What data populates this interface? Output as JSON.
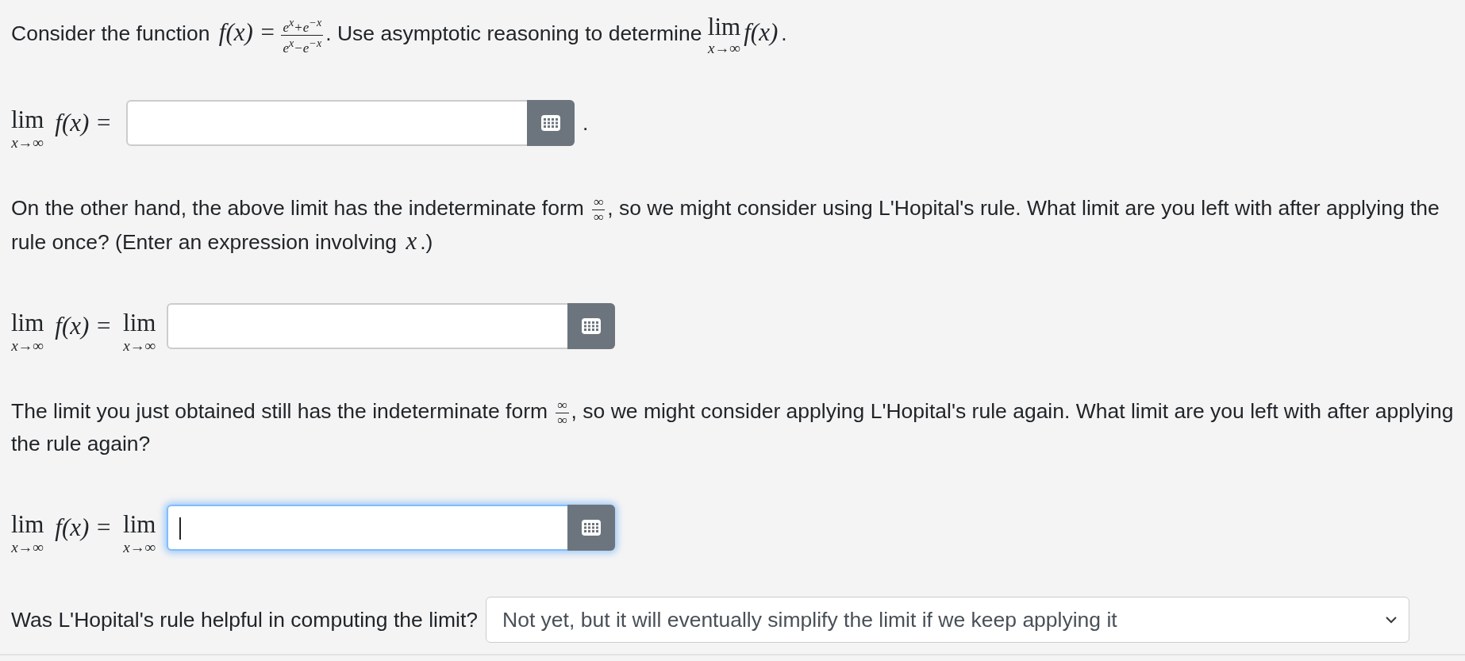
{
  "blocks": [
    {
      "kind": "p",
      "parts": [
        {
          "kind": "text",
          "text": "Consider the function "
        },
        {
          "kind": "math",
          "text": "f(x) ="
        },
        {
          "kind": "frac",
          "num": "e$^{x}$+e$^{−x}$",
          "den": "e$^{x}$−e$^{−x}$"
        },
        {
          "kind": "text",
          "text": ". Use asymptotic reasoning to determine "
        },
        {
          "kind": "lim",
          "text": "lim",
          "sub": "x→∞"
        },
        {
          "kind": "math",
          "text": "f(x)"
        },
        {
          "kind": "text",
          "text": "."
        }
      ]
    },
    {
      "kind": "answer",
      "focused": false,
      "parts": [
        {
          "kind": "lim",
          "text": "lim",
          "sub": "x→∞"
        },
        {
          "kind": "math",
          "text": "f(x) ="
        }
      ],
      "after": "."
    },
    {
      "kind": "p",
      "parts": [
        {
          "kind": "text",
          "text": "On the other hand, the above limit has the indeterminate form "
        },
        {
          "kind": "frac",
          "num": "∞",
          "den": "∞"
        },
        {
          "kind": "text",
          "text": ", so we might consider using L'Hopital's rule. What limit are you left with after applying the rule once? (Enter an expression involving "
        },
        {
          "kind": "math",
          "text": "x"
        },
        {
          "kind": "text",
          "text": ".)"
        }
      ]
    },
    {
      "kind": "answer",
      "focused": false,
      "parts": [
        {
          "kind": "lim",
          "text": "lim",
          "sub": "x→∞"
        },
        {
          "kind": "math",
          "text": "f(x) ="
        },
        {
          "kind": "lim",
          "text": "lim",
          "sub": "x→∞"
        }
      ]
    },
    {
      "kind": "p",
      "parts": [
        {
          "kind": "text",
          "text": "The limit you just obtained still has the indeterminate form "
        },
        {
          "kind": "frac",
          "num": "∞",
          "den": "∞"
        },
        {
          "kind": "text",
          "text": ", so we might consider applying L'Hopital's rule again. What limit are you left with after applying the rule again?"
        }
      ]
    },
    {
      "kind": "answer",
      "focused": true,
      "parts": [
        {
          "kind": "lim",
          "text": "lim",
          "sub": "x→∞"
        },
        {
          "kind": "math",
          "text": "f(x) ="
        },
        {
          "kind": "lim",
          "text": "lim",
          "sub": "x→∞"
        }
      ]
    },
    {
      "kind": "select",
      "label": "Was L'Hopital's rule helpful in computing the limit?",
      "value": "Not yet, but it will eventually simplify the limit if we keep applying it"
    }
  ]
}
